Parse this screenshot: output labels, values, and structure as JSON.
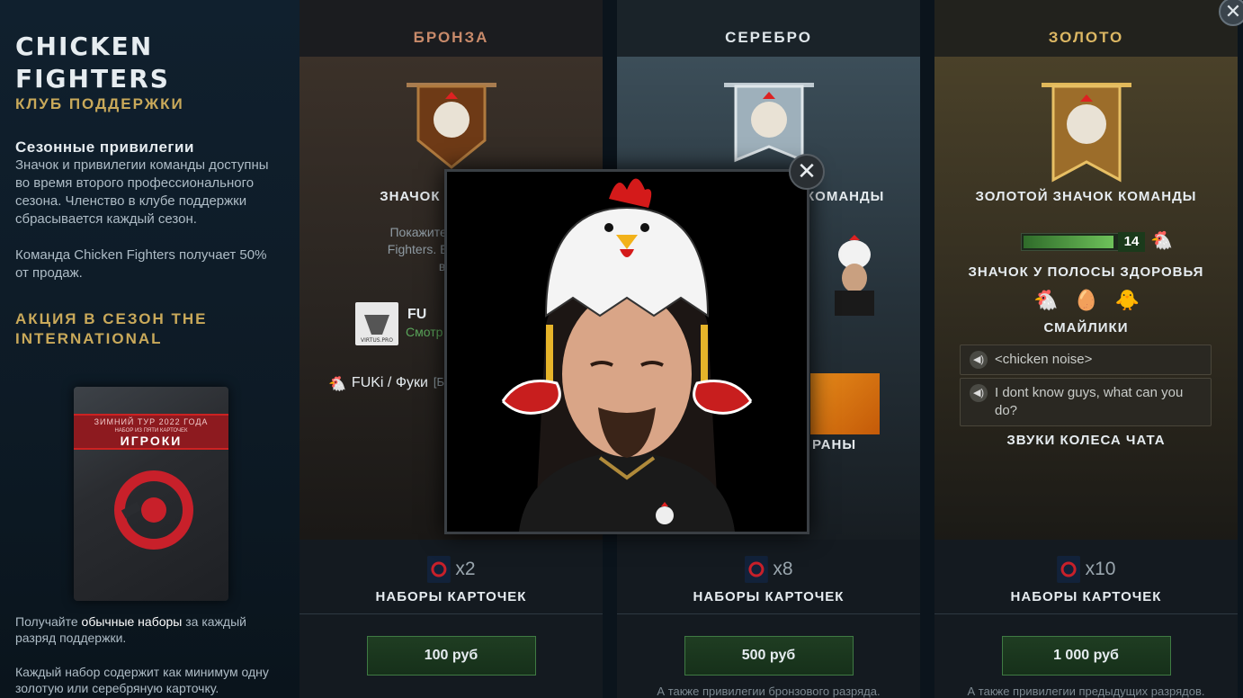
{
  "sidebar": {
    "title_line1": "CHICKEN",
    "title_line2": "FIGHTERS",
    "subtitle": "КЛУБ ПОДДЕРЖКИ",
    "season_heading": "Сезонные привилегии",
    "season_text": "Значок и привилегии команды доступны во время второго профессионального сезона. Членство в клубе поддержки сбрасывается каждый сезон.",
    "team_share_text": "Команда Chicken Fighters получает 50% от продаж.",
    "promo_heading": "АКЦИЯ В СЕЗОН THE INTERNATIONAL",
    "pack": {
      "line1": "ЗИМНИЙ ТУР 2022 ГОДА",
      "line2": "НАБОР ИЗ ПЯТИ КАРТОЧЕК",
      "line3": "ИГРОКИ"
    },
    "bottom_text_pre": "Получайте ",
    "bottom_text_bold": "обычные наборы",
    "bottom_text_post": " за каждый разряд поддержки.",
    "bottom_text2": "Каждый набор содержит как минимум одну золотую или серебряную карточку."
  },
  "tiers": [
    {
      "name": "БРОНЗА",
      "badge_label": "ЗНАЧОК КОМАНДЫ",
      "badge_label_visible": "ЗНАЧОК К",
      "desc_visible": "Покажите, что под\nFighters. Её значок\nвашим им",
      "profile_name": "FU",
      "profile_sub": "Смотр",
      "chat_name": "FUKi / Фуки",
      "chat_suffix": "[Б",
      "pack_multiplier": "x2",
      "pack_label": "НАБОРЫ КАРТОЧЕК",
      "price": "100 руб",
      "also_text": ""
    },
    {
      "name": "СЕРЕБРО",
      "badge_label_visible": "КОМАНДЫ",
      "loading_label_visible": "РАНЫ",
      "pack_multiplier": "x8",
      "pack_label": "НАБОРЫ КАРТОЧЕК",
      "price": "500 руб",
      "also_text": "А также привилегии бронзового разряда."
    },
    {
      "name": "ЗОЛОТО",
      "badge_label": "ЗОЛОТОЙ ЗНАЧОК КОМАНДЫ",
      "healthbar_level": "14",
      "healthbar_label": "ЗНАЧОК У ПОЛОСЫ ЗДОРОВЬЯ",
      "emotes_label": "СМАЙЛИКИ",
      "chat_sounds": [
        "<chicken noise>",
        "I dont know guys, what can you do?"
      ],
      "chatwheel_label": "ЗВУКИ КОЛЕСА ЧАТА",
      "pack_multiplier": "x10",
      "pack_label": "НАБОРЫ КАРТОЧЕК",
      "price": "1 000 руб",
      "also_text": "А также привилегии предыдущих разрядов."
    }
  ],
  "modal": {
    "close_symbol": "✕"
  },
  "window": {
    "close_symbol": "✕"
  },
  "colors": {
    "bronze": "#c88a6a",
    "gold": "#dcb763",
    "buy_button": "#1f3d22",
    "accent_red": "#c22"
  }
}
